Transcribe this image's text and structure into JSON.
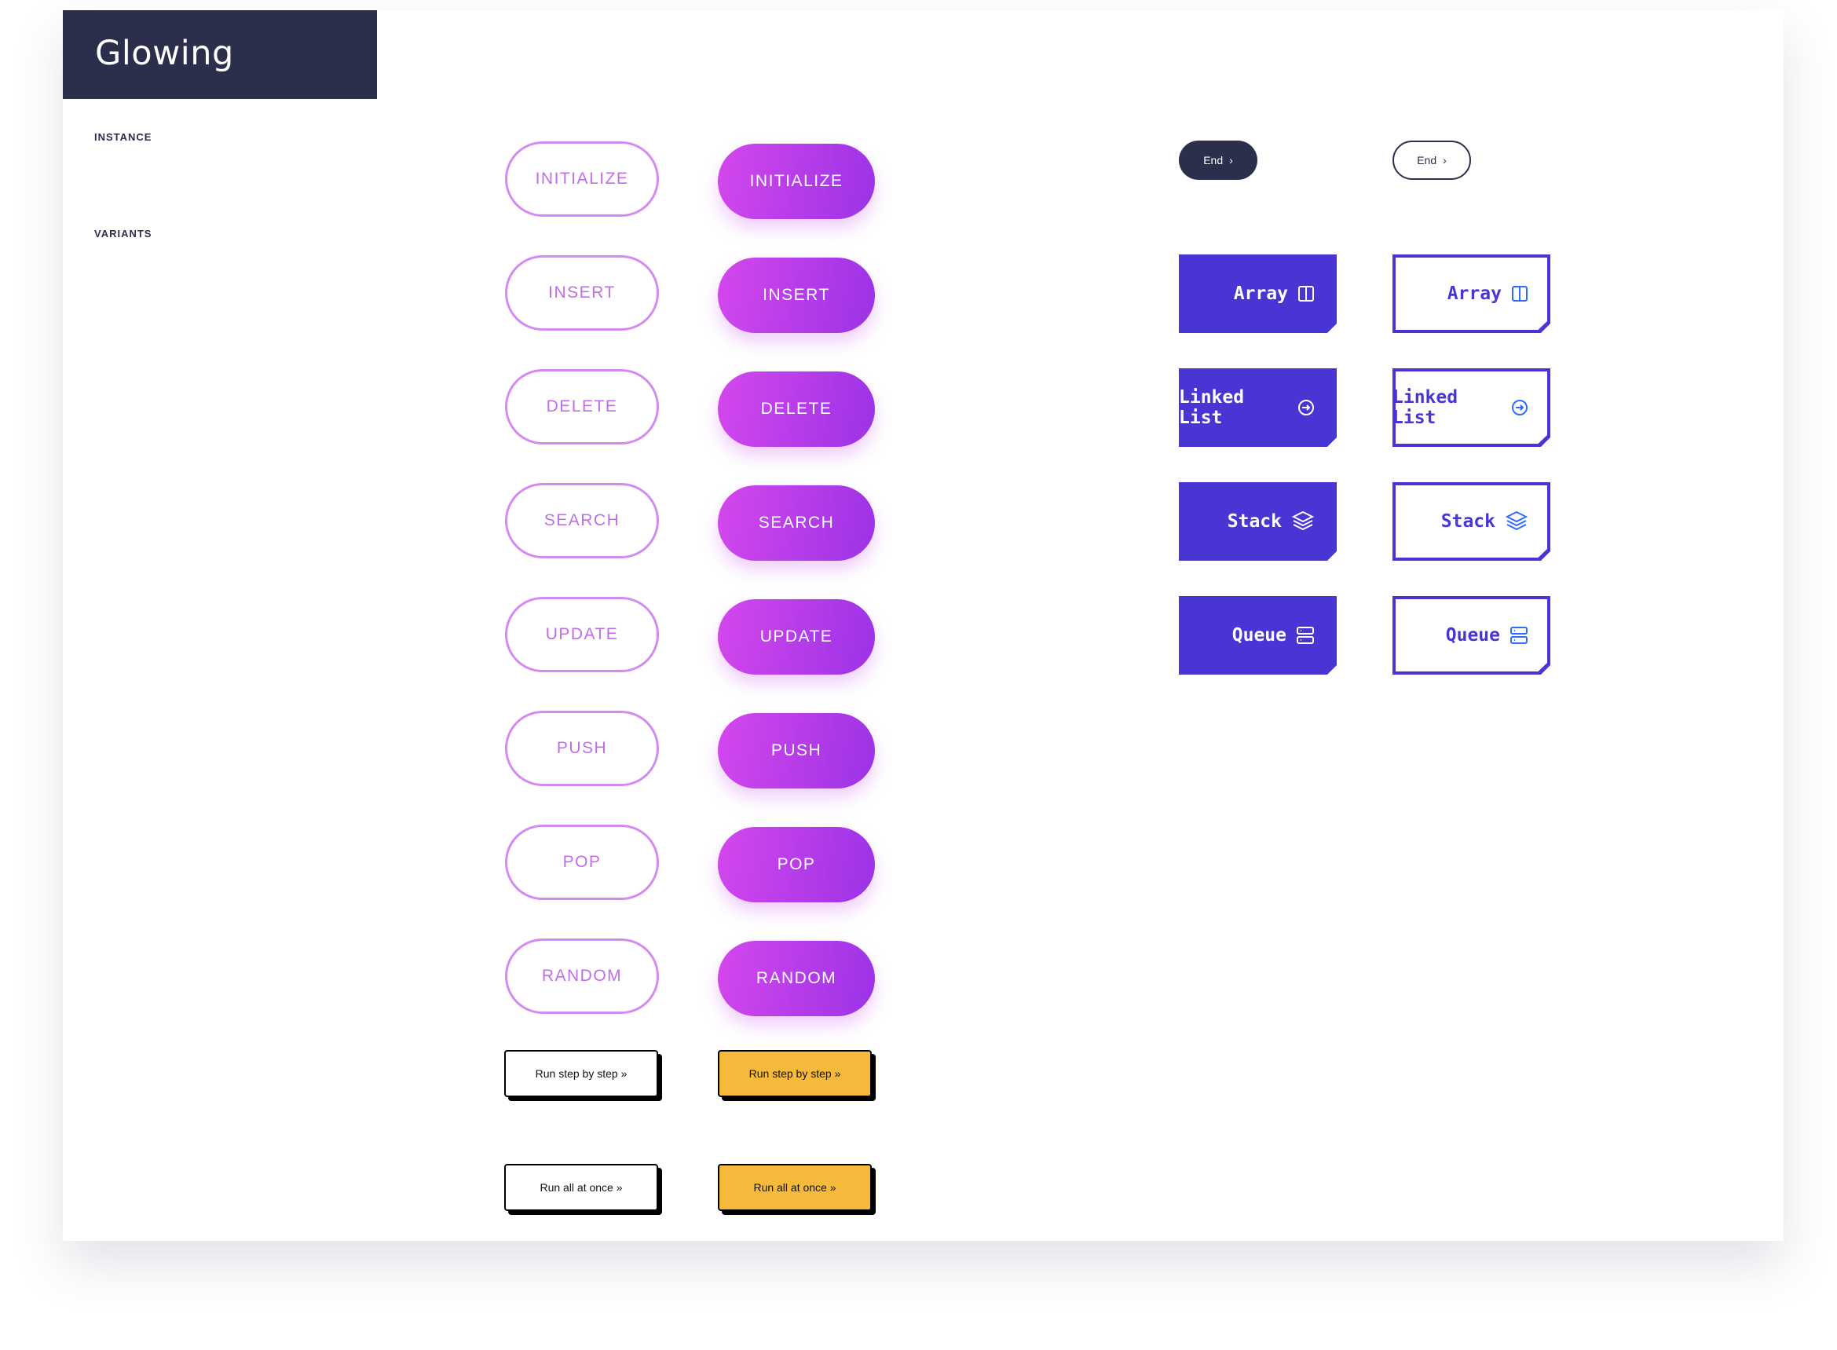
{
  "header": {
    "title": "Glowing"
  },
  "sections": {
    "instance": "INSTANCE",
    "variants": "VARIANTS"
  },
  "operations": [
    "INITIALIZE",
    "INSERT",
    "DELETE",
    "SEARCH",
    "UPDATE",
    "PUSH",
    "POP",
    "RANDOM"
  ],
  "run_buttons": [
    {
      "label": "Run step by step »"
    },
    {
      "label": "Run all at once »"
    }
  ],
  "end_button": {
    "label": "End",
    "icon": "chevron-right-icon"
  },
  "data_structures": [
    {
      "label": "Array",
      "icon": "columns-icon"
    },
    {
      "label": "Linked List",
      "icon": "arrow-circle-right-icon"
    },
    {
      "label": "Stack",
      "icon": "layers-icon"
    },
    {
      "label": "Queue",
      "icon": "server-icon"
    }
  ],
  "colors": {
    "header": "#2c2f4b",
    "purple_start": "#d447ec",
    "purple_end": "#9b33e6",
    "indigo": "#4935d4",
    "yellow": "#f5b93c",
    "icon_blue": "#2f6bff"
  }
}
